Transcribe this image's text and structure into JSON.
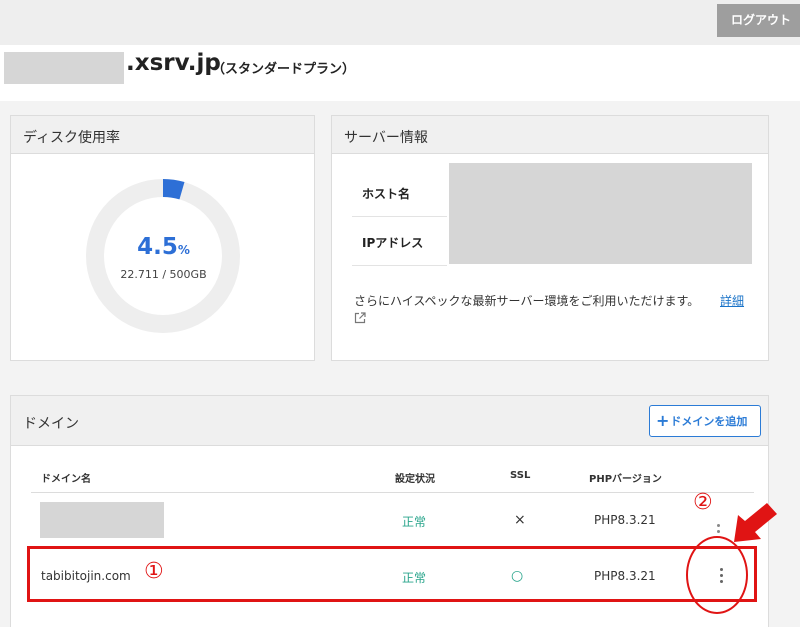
{
  "header": {
    "logout_label": "ログアウト"
  },
  "server": {
    "name": ".xsrv.jp",
    "plan": "（スタンダードプラン）"
  },
  "disk": {
    "title": "ディスク使用率",
    "percent": "4.5",
    "percent_unit": "%",
    "usage": "22.711 / 500GB",
    "usage_fraction": 0.045,
    "color": "#2d6fd6"
  },
  "server_info": {
    "title": "サーバー情報",
    "hostname_label": "ホスト名",
    "ip_label": "IPアドレス",
    "spec_text": "さらにハイスペックな最新サーバー環境をご利用いただけます。",
    "detail_link": "詳細"
  },
  "domain": {
    "title": "ドメイン",
    "add_label": "ドメインを追加",
    "columns": [
      "ドメイン名",
      "設定状況",
      "SSL",
      "PHPバージョン"
    ],
    "rows": [
      {
        "name": "",
        "status": "正常",
        "ssl": "×",
        "php": "PHP8.3.21"
      },
      {
        "name": "tabibitojin.com",
        "status": "正常",
        "ssl": "○",
        "php": "PHP8.3.21"
      }
    ]
  },
  "annotations": {
    "marker1": "①",
    "marker2": "②",
    "color": "#e01414"
  }
}
